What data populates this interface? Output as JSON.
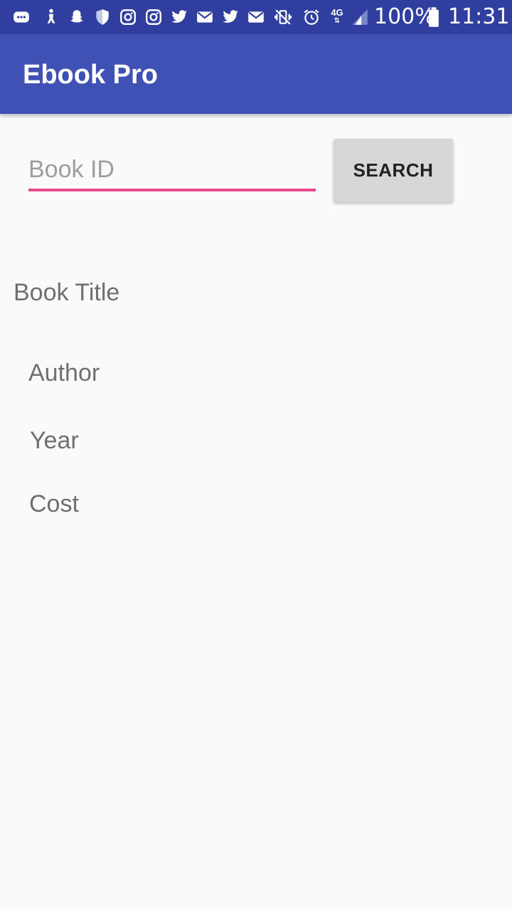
{
  "status_bar": {
    "icons": [
      "message-icon",
      "figure-icon",
      "snapchat-icon",
      "shield-icon",
      "instagram-icon",
      "instagram-icon",
      "twitter-icon",
      "gmail-icon",
      "twitter-icon",
      "gmail-icon",
      "vibrate-icon",
      "alarm-icon"
    ],
    "network": "4G",
    "battery": "100%",
    "time": "11:31"
  },
  "app_bar": {
    "title": "Ebook Pro"
  },
  "search": {
    "placeholder": "Book ID",
    "value": "",
    "button_label": "SEARCH"
  },
  "details": {
    "title": "Book Title",
    "author": "Author",
    "year": "Year",
    "cost": "Cost"
  },
  "colors": {
    "status_bar": "#303f9f",
    "app_bar": "#3f51b5",
    "accent": "#e84c88",
    "background": "#fafafa"
  }
}
